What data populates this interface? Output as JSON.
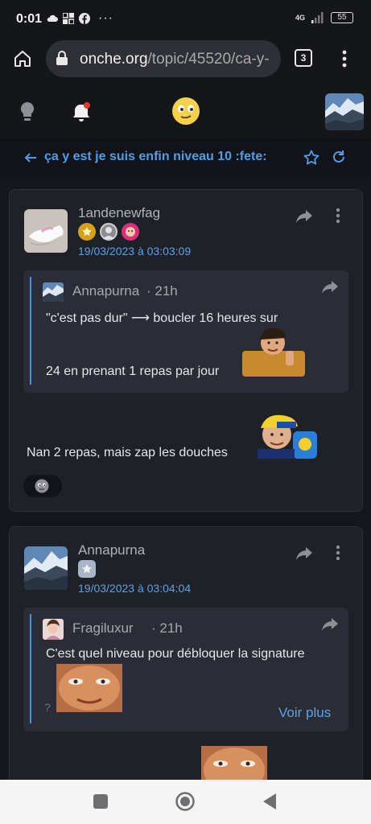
{
  "status_bar": {
    "time": "0:01",
    "icons": [
      "cloud-icon",
      "grid-icon",
      "facebook-icon",
      "more-icon"
    ],
    "network": "4G",
    "battery": "55"
  },
  "browser": {
    "url_domain": "onche.org",
    "url_path": "/topic/45520/ca-y-",
    "tab_count": "3"
  },
  "topic": {
    "title": "ça y est je suis enfin niveau 10 :fete:"
  },
  "posts": [
    {
      "username": "1andenewfag",
      "date": "19/03/2023 à 03:03:09",
      "quote": {
        "author": "Annapurna",
        "time": "· 21h",
        "line1": "\"c'est pas dur\" ⟶ boucler 16 heures sur",
        "line2": "24 en prenant 1 repas par jour"
      },
      "body": "Nan 2 repas, mais zap les douches"
    },
    {
      "username": "Annapurna",
      "date": "19/03/2023 à 03:04:04",
      "quote": {
        "author": "Fragiluxur",
        "time": "· 21h",
        "line1": "C'est quel niveau pour débloquer la signature",
        "marker": "?",
        "more": "Voir plus"
      }
    }
  ],
  "colors": {
    "accent": "#4f9ee8",
    "background": "#15171c",
    "card": "#1f2128",
    "quote": "#2a2d35"
  }
}
